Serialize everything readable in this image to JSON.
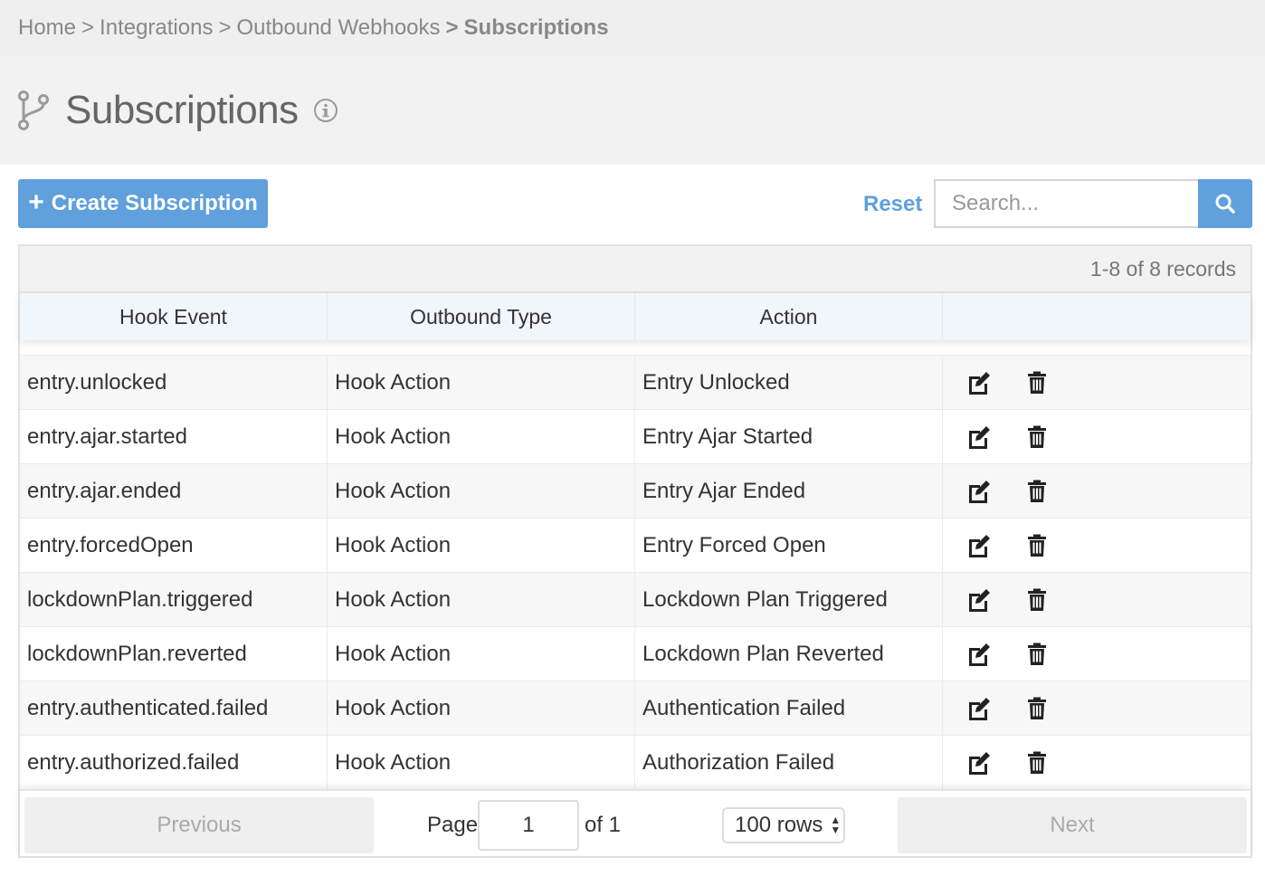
{
  "breadcrumb": {
    "items": [
      "Home",
      "Integrations",
      "Outbound Webhooks"
    ],
    "separator": ">",
    "current": "Subscriptions"
  },
  "page": {
    "title": "Subscriptions",
    "title_icon": "code-branch-icon",
    "info_icon": "info-circle-icon"
  },
  "toolbar": {
    "create_icon": "plus",
    "create_label": "Create Subscription",
    "reset_label": "Reset",
    "search_placeholder": "Search...",
    "search_value": "",
    "search_icon": "magnifier-icon"
  },
  "colors": {
    "accent": "#5fa0dd",
    "header_bg": "#f1f6fb",
    "row_alt": "#f7f7f7"
  },
  "table": {
    "record_summary": "1-8 of 8 records",
    "columns": [
      "Hook Event",
      "Outbound Type",
      "Action",
      ""
    ],
    "rows": [
      {
        "event": "entry.unlocked",
        "type": "Hook Action",
        "action": "Entry Unlocked"
      },
      {
        "event": "entry.ajar.started",
        "type": "Hook Action",
        "action": "Entry Ajar Started"
      },
      {
        "event": "entry.ajar.ended",
        "type": "Hook Action",
        "action": "Entry Ajar Ended"
      },
      {
        "event": "entry.forcedOpen",
        "type": "Hook Action",
        "action": "Entry Forced Open"
      },
      {
        "event": "lockdownPlan.triggered",
        "type": "Hook Action",
        "action": "Lockdown Plan Triggered"
      },
      {
        "event": "lockdownPlan.reverted",
        "type": "Hook Action",
        "action": "Lockdown Plan Reverted"
      },
      {
        "event": "entry.authenticated.failed",
        "type": "Hook Action",
        "action": "Authentication Failed"
      },
      {
        "event": "entry.authorized.failed",
        "type": "Hook Action",
        "action": "Authorization Failed"
      }
    ],
    "row_actions": [
      "edit-icon",
      "trash-icon"
    ]
  },
  "pagination": {
    "previous_label": "Previous",
    "next_label": "Next",
    "page_label": "Page",
    "page_value": "1",
    "of_label": "of 1",
    "rows_label": "100 rows"
  }
}
